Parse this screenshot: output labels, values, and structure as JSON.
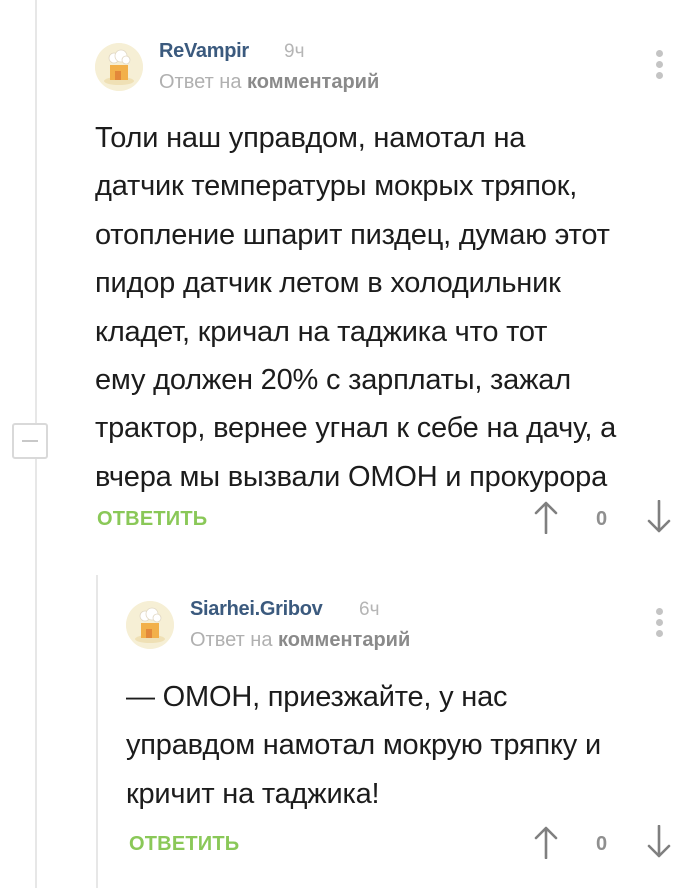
{
  "comments": [
    {
      "author": "ReVampir",
      "time": "9ч",
      "reply_prefix": "Ответ на",
      "reply_target": "комментарий",
      "text": "Толи наш управдом, намотал на\nдатчик температуры мокрых тряпок,\nотопление шпарит пиздец, думаю этот\nпидор датчик летом в холодильник\nкладет, кричал на таджика что тот\nему должен 20% с зарплаты, зажал\nтрактор, вернее угнал к себе на дачу, а\nвчера мы вызвали ОМОН и прокурора",
      "reply_label": "ОТВЕТИТЬ",
      "score": "0"
    },
    {
      "author": "Siarhei.Gribov",
      "time": "6ч",
      "reply_prefix": "Ответ на",
      "reply_target": "комментарий",
      "text": "— ОМОН, приезжайте, у нас\nуправдом намотал мокрую тряпку и\nкричит на таджика!",
      "reply_label": "ОТВЕТИТЬ",
      "score": "0"
    }
  ],
  "icons": {
    "avatar": "default-avatar-icon",
    "menu": "vertical-dots-icon",
    "vote_up": "arrow-up-icon",
    "vote_down": "arrow-down-icon",
    "collapse": "minus-icon"
  },
  "colors": {
    "author": "#3b5a7e",
    "reply_action": "#8ac858",
    "meta": "#b0b0b0"
  }
}
